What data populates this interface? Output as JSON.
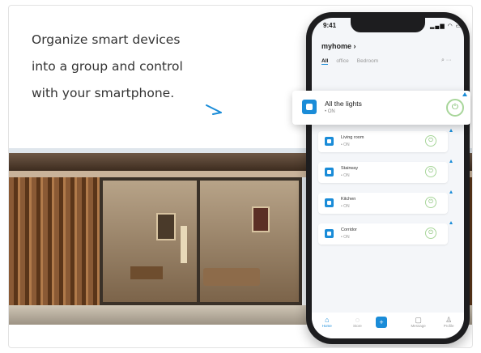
{
  "caption": {
    "line1": "Organize smart devices",
    "line2": "into a group and control",
    "line3": "with your smartphone."
  },
  "phone": {
    "time": "9:41",
    "status_icons": "▂▄▆ ◠ ▭",
    "home_title": "myhome ›",
    "tabs": [
      "All",
      "office",
      "Bedroom"
    ],
    "tab_icons": "⌕ ···",
    "devices": [
      {
        "name": "Living room",
        "state": "• ON"
      },
      {
        "name": "Stairway",
        "state": "• ON"
      },
      {
        "name": "Kitchen",
        "state": "• ON"
      },
      {
        "name": "Corridor",
        "state": "• ON"
      }
    ],
    "nav": [
      {
        "label": "Home",
        "glyph": "⌂"
      },
      {
        "label": "Store",
        "glyph": "◌"
      },
      {
        "label": "",
        "glyph": "+"
      },
      {
        "label": "Message",
        "glyph": "▢"
      },
      {
        "label": "Profile",
        "glyph": "♙"
      }
    ]
  },
  "popup": {
    "name": "All the lights",
    "state": "• ON",
    "power_glyph": "⏻"
  },
  "colors": {
    "accent": "#1a8cd8",
    "power_green": "#6db45a",
    "caption_text": "#333333"
  }
}
